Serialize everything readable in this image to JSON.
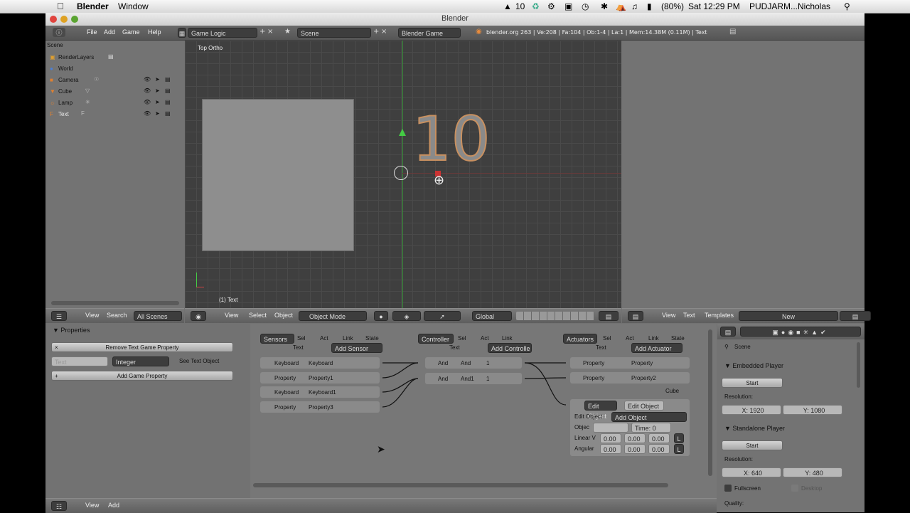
{
  "macmenu": {
    "app": "Blender",
    "window": "Window",
    "battery": "(80%)",
    "clock": "Sat 12:29 PM",
    "user": "PUDJARM...Nicholas",
    "count": "10"
  },
  "window": {
    "title": "Blender"
  },
  "infobar": {
    "file": "File",
    "add": "Add",
    "game": "Game",
    "help": "Help",
    "layout": "Game Logic",
    "scene": "Scene",
    "engine": "Blender Game",
    "stats": "blender.org 263 | Ve:208 | Fa:104 | Ob:1-4 | La:1 | Mem:14.38M (0.11M) | Text"
  },
  "outliner": {
    "root": "Scene",
    "items": [
      "RenderLayers",
      "World",
      "Camera",
      "Cube",
      "Lamp",
      "Text"
    ]
  },
  "viewport": {
    "view_label": "Top Ortho",
    "object_label": "(1) Text",
    "text_object": "10"
  },
  "viewhdr": {
    "view": "View",
    "select": "Select",
    "object": "Object",
    "mode": "Object Mode",
    "orientation": "Global"
  },
  "outhdr": {
    "view": "View",
    "search": "Search",
    "scenes": "All Scenes"
  },
  "texthdr": {
    "view": "View",
    "text": "Text",
    "templates": "Templates",
    "new": "New"
  },
  "props": {
    "title": "Properties",
    "remove": "Remove Text Game Property",
    "name": "Text",
    "type": "Integer",
    "see_text": "See Text Object",
    "add": "Add Game Property"
  },
  "logic": {
    "sensors_hdr": "Sensors",
    "controller_hdr": "Controller",
    "actuators_hdr": "Actuators",
    "sel": "Sel",
    "act": "Act",
    "link": "Link",
    "state": "State",
    "obj": "Text",
    "add_sensor": "Add Sensor",
    "add_controller": "Add Controlle",
    "add_actuator": "Add Actuator",
    "sensors": [
      {
        "type": "Keyboard",
        "name": "Keyboard"
      },
      {
        "type": "Property",
        "name": "Property1"
      },
      {
        "type": "Keyboard",
        "name": "Keyboard1"
      },
      {
        "type": "Property",
        "name": "Property3"
      }
    ],
    "controllers": [
      {
        "type": "And",
        "name": "And",
        "num": "1"
      },
      {
        "type": "And",
        "name": "And1",
        "num": "1"
      }
    ],
    "actuators": [
      {
        "type": "Property",
        "name": "Property"
      },
      {
        "type": "Property",
        "name": "Property2"
      }
    ],
    "cube": "Cube",
    "edit": {
      "type": "Edit Object",
      "name": "Edit Object",
      "label": "Edit Object:",
      "value": "Add Object",
      "objec": "Objec",
      "time": "Time: 0",
      "linear": "Linear V",
      "angular": "Angular",
      "zero": "0.00",
      "l": "L"
    }
  },
  "scenepanel": {
    "scene": "Scene",
    "embedded": "Embedded Player",
    "start": "Start",
    "resolution": "Resolution:",
    "x1": "X: 1920",
    "y1": "Y: 1080",
    "standalone": "Standalone Player",
    "start2": "Start",
    "x2": "X: 640",
    "y2": "Y: 480",
    "fullscreen": "Fullscreen",
    "desktop": "Desktop",
    "quality": "Quality:"
  },
  "bottomhdr": {
    "view": "View",
    "add": "Add"
  }
}
